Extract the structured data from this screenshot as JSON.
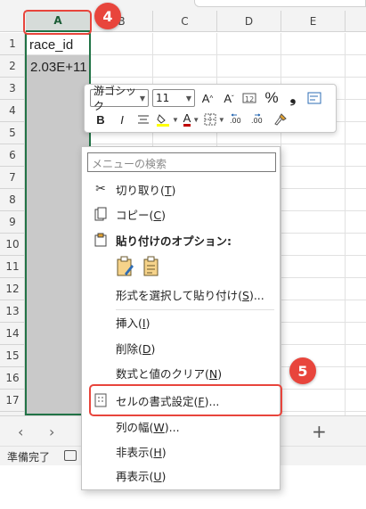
{
  "columns": [
    "A",
    "B",
    "C",
    "D",
    "E"
  ],
  "rows": [
    "1",
    "2",
    "3",
    "4",
    "5",
    "6",
    "7",
    "8",
    "9",
    "10",
    "11",
    "12",
    "13",
    "14",
    "15",
    "16",
    "17"
  ],
  "cells": {
    "A1": "race_id",
    "A2": "2.03E+11"
  },
  "mini_toolbar": {
    "font_name": "游ゴシック",
    "font_size": "11",
    "grow_font": "A^",
    "shrink_font": "Aˇ",
    "percent": "%",
    "comma": "❟",
    "bold": "B",
    "italic": "I",
    "font_color_letter": "A"
  },
  "context_menu": {
    "search_placeholder": "メニューの検索",
    "cut": "切り取り(",
    "cut_key": "T",
    "copy": "コピー(",
    "copy_key": "C",
    "paste_options_title": "貼り付けのオプション:",
    "paste_special": "形式を選択して貼り付け(",
    "paste_special_key": "S",
    "paste_special_tail": ")...",
    "insert": "挿入(",
    "insert_key": "I",
    "delete": "削除(",
    "delete_key": "D",
    "clear": "数式と値のクリア(",
    "clear_key": "N",
    "format_cells": "セルの書式設定(",
    "format_cells_key": "F",
    "format_cells_tail": ")...",
    "col_width": "列の幅(",
    "col_width_key": "W",
    "col_width_tail": ")...",
    "hide": "非表示(",
    "hide_key": "H",
    "unhide": "再表示(",
    "unhide_key": "U",
    "close_paren": ")"
  },
  "markers": {
    "step4": "4",
    "step5": "5"
  },
  "status": {
    "ready": "準備完了"
  },
  "tabs": {
    "plus": "+",
    "prev": "‹",
    "next": "›"
  },
  "colors": {
    "accent_green": "#217346",
    "marker_red": "#e8453c"
  }
}
